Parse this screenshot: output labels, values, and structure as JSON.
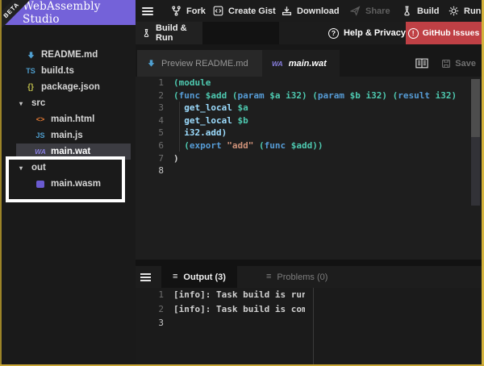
{
  "brand": {
    "title": "WebAssembly Studio",
    "beta": "BETA"
  },
  "toolbar": {
    "fork": "Fork",
    "create_gist": "Create Gist",
    "download": "Download",
    "share": "Share",
    "build": "Build",
    "run": "Run"
  },
  "bar2": {
    "build_run": "Build & Run",
    "help": "Help & Privacy",
    "issues": "GitHub Issues"
  },
  "sidebar": {
    "files": [
      {
        "name": "README.md",
        "icon": "md",
        "indent": 1
      },
      {
        "name": "build.ts",
        "icon": "ts",
        "indent": 1
      },
      {
        "name": "package.json",
        "icon": "json",
        "indent": 1
      },
      {
        "name": "src",
        "icon": "folder",
        "indent": 0
      },
      {
        "name": "main.html",
        "icon": "html",
        "indent": 2
      },
      {
        "name": "main.js",
        "icon": "js",
        "indent": 2
      },
      {
        "name": "main.wat",
        "icon": "wa",
        "indent": 2,
        "selected": true
      },
      {
        "name": "out",
        "icon": "folder",
        "indent": 0
      },
      {
        "name": "main.wasm",
        "icon": "wasm",
        "indent": 2
      }
    ]
  },
  "tabs": {
    "preview": "Preview README.md",
    "wat": "main.wat",
    "wat_badge": "WA",
    "save": "Save"
  },
  "editor": {
    "lines": [
      {
        "n": "1",
        "tokens": [
          {
            "t": "(module",
            "c": "teal"
          }
        ]
      },
      {
        "n": "2",
        "tokens": [
          {
            "t": "(",
            "c": "teal"
          },
          {
            "t": "func ",
            "c": "blue"
          },
          {
            "t": "$add ",
            "c": "teal"
          },
          {
            "t": "(",
            "c": "teal"
          },
          {
            "t": "param ",
            "c": "blue"
          },
          {
            "t": "$a i32",
            "c": "teal"
          },
          {
            "t": ") ",
            "c": "teal"
          },
          {
            "t": "(",
            "c": "teal"
          },
          {
            "t": "param ",
            "c": "blue"
          },
          {
            "t": "$b i32",
            "c": "teal"
          },
          {
            "t": ") ",
            "c": "teal"
          },
          {
            "t": "(",
            "c": "teal"
          },
          {
            "t": "result ",
            "c": "blue"
          },
          {
            "t": "i32",
            "c": "teal"
          },
          {
            "t": ")",
            "c": "teal"
          }
        ]
      },
      {
        "n": "3",
        "tokens": [
          {
            "t": "  ",
            "c": "fg"
          },
          {
            "t": "get_local ",
            "c": "cyan"
          },
          {
            "t": "$a",
            "c": "teal"
          }
        ]
      },
      {
        "n": "4",
        "tokens": [
          {
            "t": "  ",
            "c": "fg"
          },
          {
            "t": "get_local ",
            "c": "cyan"
          },
          {
            "t": "$b",
            "c": "teal"
          }
        ]
      },
      {
        "n": "5",
        "tokens": [
          {
            "t": "  ",
            "c": "fg"
          },
          {
            "t": "i32.add)",
            "c": "cyan"
          }
        ]
      },
      {
        "n": "6",
        "tokens": [
          {
            "t": "  ",
            "c": "fg"
          },
          {
            "t": "(",
            "c": "teal"
          },
          {
            "t": "export ",
            "c": "blue"
          },
          {
            "t": "\"add\" ",
            "c": "str"
          },
          {
            "t": "(",
            "c": "teal"
          },
          {
            "t": "func ",
            "c": "blue"
          },
          {
            "t": "$add",
            "c": "teal"
          },
          {
            "t": "))",
            "c": "teal"
          }
        ]
      },
      {
        "n": "7",
        "tokens": [
          {
            "t": ")",
            "c": "fg"
          }
        ]
      },
      {
        "n": "8",
        "tokens": [],
        "bright": true
      }
    ]
  },
  "panel": {
    "output_tab": "Output (3)",
    "problems_tab": "Problems (0)",
    "lines": [
      {
        "n": "1",
        "text": "[info]: Task build is runn"
      },
      {
        "n": "2",
        "text": "[info]: Task build is comp"
      },
      {
        "n": "3",
        "text": "",
        "bright": true
      }
    ]
  },
  "colors": {
    "accent_purple": "#7462d9",
    "focus_border_gold": "#d4b33c",
    "issues_red": "#bf4045",
    "selection_grey": "#3c3c42",
    "code_teal": "#4EC9B0",
    "code_blue": "#569CD6",
    "code_cyan": "#9CDCFE",
    "code_string": "#CE9178",
    "icon_blue": "#4f9fd0",
    "icon_orange": "#e37933",
    "icon_purple": "#897fe0"
  }
}
